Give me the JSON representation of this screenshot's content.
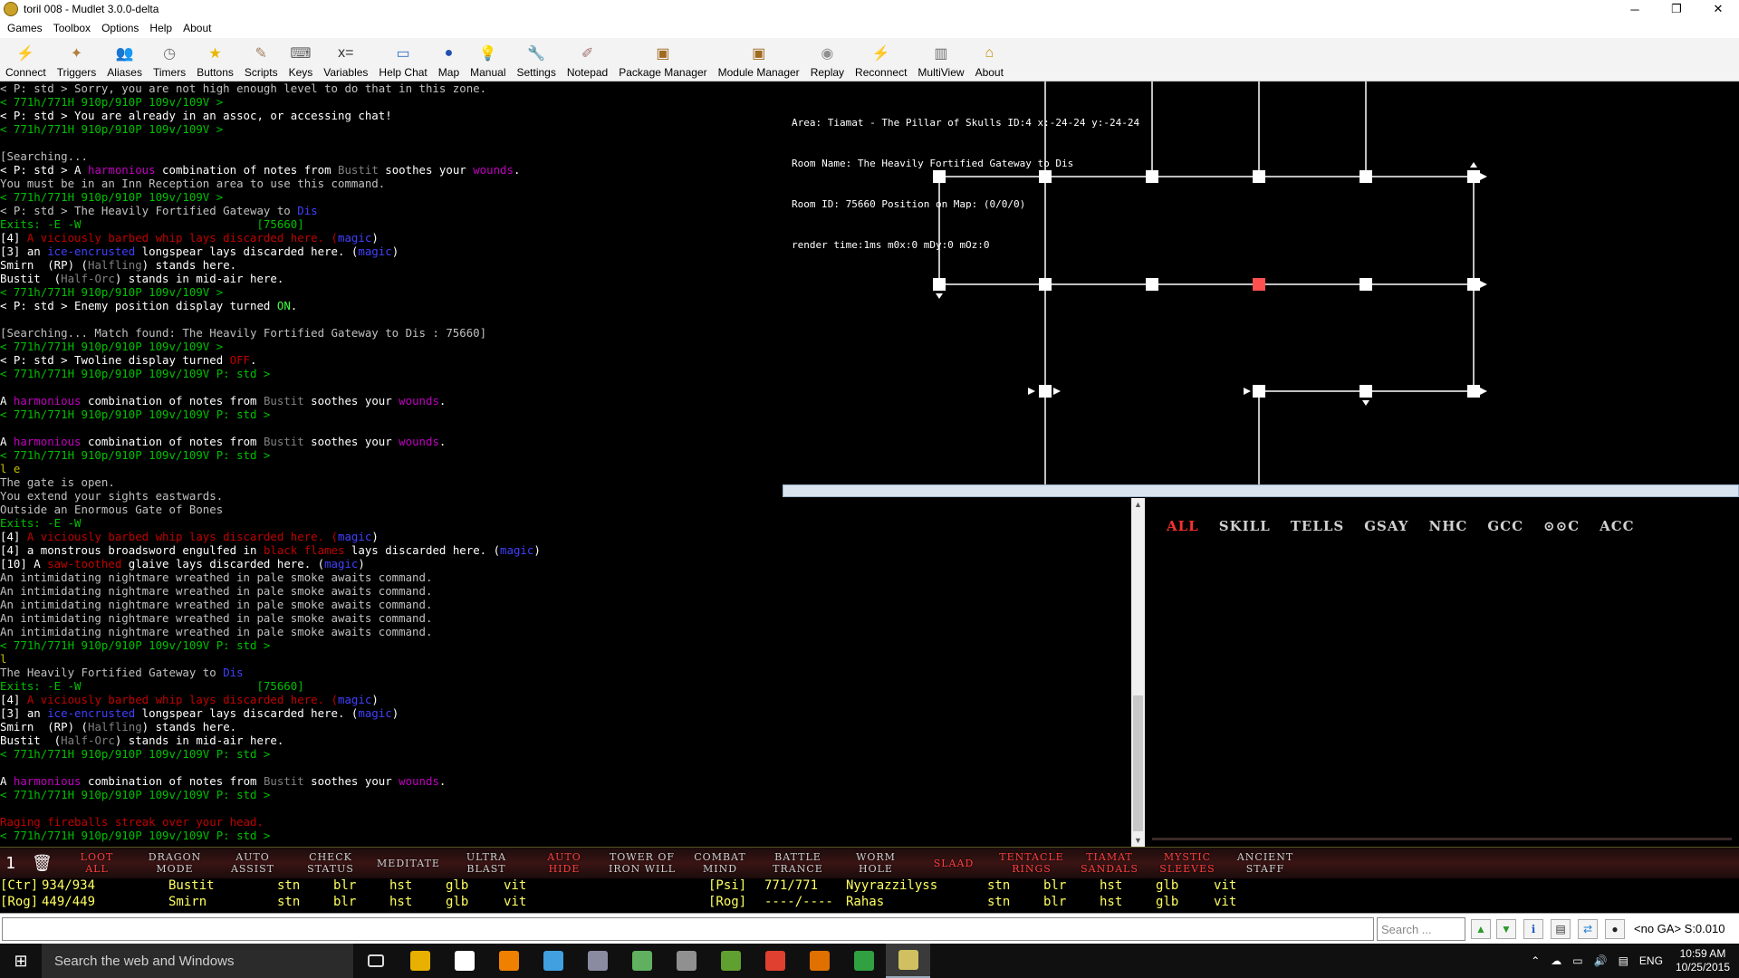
{
  "window": {
    "title": "toril 008 - Mudlet 3.0.0-delta",
    "minimize": "─",
    "maximize": "❐",
    "close": "✕"
  },
  "menu": [
    "Games",
    "Toolbox",
    "Options",
    "Help",
    "About"
  ],
  "toolbar": [
    {
      "label": "Connect",
      "icon": "connect-icon",
      "glyph": "⚡",
      "color": "#e8a000"
    },
    {
      "label": "Triggers",
      "icon": "triggers-icon",
      "glyph": "✦",
      "color": "#b08040"
    },
    {
      "label": "Aliases",
      "icon": "aliases-icon",
      "glyph": "👥",
      "color": "#806040"
    },
    {
      "label": "Timers",
      "icon": "timers-icon",
      "glyph": "◷",
      "color": "#707070"
    },
    {
      "label": "Buttons",
      "icon": "buttons-icon",
      "glyph": "★",
      "color": "#e8b800"
    },
    {
      "label": "Scripts",
      "icon": "scripts-icon",
      "glyph": "✎",
      "color": "#a08060"
    },
    {
      "label": "Keys",
      "icon": "keys-icon",
      "glyph": "⌨",
      "color": "#606060"
    },
    {
      "label": "Variables",
      "icon": "variables-icon",
      "glyph": "x=",
      "color": "#333333"
    },
    {
      "label": "Help Chat",
      "icon": "help-chat-icon",
      "glyph": "▭",
      "color": "#3070c0"
    },
    {
      "label": "Map",
      "icon": "map-icon",
      "glyph": "●",
      "color": "#2050b0"
    },
    {
      "label": "Manual",
      "icon": "manual-icon",
      "glyph": "💡",
      "color": "#e0c000"
    },
    {
      "label": "Settings",
      "icon": "settings-icon",
      "glyph": "🔧",
      "color": "#808080"
    },
    {
      "label": "Notepad",
      "icon": "notepad-icon",
      "glyph": "✐",
      "color": "#a07070"
    },
    {
      "label": "Package Manager",
      "icon": "package-manager-icon",
      "glyph": "▣",
      "color": "#a06a20"
    },
    {
      "label": "Module Manager",
      "icon": "module-manager-icon",
      "glyph": "▣",
      "color": "#a06a20"
    },
    {
      "label": "Replay",
      "icon": "replay-icon",
      "glyph": "◉",
      "color": "#909090"
    },
    {
      "label": "Reconnect",
      "icon": "reconnect-icon",
      "glyph": "⚡",
      "color": "#e8a000"
    },
    {
      "label": "MultiView",
      "icon": "multiview-icon",
      "glyph": "▥",
      "color": "#707070"
    },
    {
      "label": "About",
      "icon": "about-icon",
      "glyph": "⌂",
      "color": "#c09000"
    }
  ],
  "console": [
    [
      [
        "< P: std > Sorry, you are not high enough level to do that in this zone.",
        "gray"
      ]
    ],
    [
      [
        "< 771h/771H 910p/910P 109v/109V >",
        "green"
      ]
    ],
    [
      [
        "< P: std > You are already in an assoc, or accessing chat!",
        "white"
      ]
    ],
    [
      [
        "< 771h/771H 910p/910P 109v/109V >",
        "green"
      ]
    ],
    [
      [
        "",
        ""
      ]
    ],
    [
      [
        "[Searching...",
        "gray"
      ]
    ],
    [
      [
        "< P: std > A ",
        "white"
      ],
      [
        "harmonious",
        "purple"
      ],
      [
        " combination of notes from ",
        "white"
      ],
      [
        "Bustit",
        "dkgray"
      ],
      [
        " soothes your ",
        "white"
      ],
      [
        "wounds",
        "purple"
      ],
      [
        ".",
        "white"
      ]
    ],
    [
      [
        "You must be in an Inn Reception area to use this command.",
        "gray"
      ]
    ],
    [
      [
        "< 771h/771H 910p/910P 109v/109V >",
        "green"
      ]
    ],
    [
      [
        "< P: std > The Heavily Fortified Gateway to ",
        "gray"
      ],
      [
        "Dis",
        "blue"
      ]
    ],
    [
      [
        "Exits: -E -W                          [75660]",
        "green"
      ]
    ],
    [
      [
        "[4] ",
        "white"
      ],
      [
        "A viciously barbed whip lays discarded here. (",
        "red"
      ],
      [
        "magic",
        "blue"
      ],
      [
        ")",
        "white"
      ]
    ],
    [
      [
        "[3] an ",
        "white"
      ],
      [
        "ice-encrusted",
        "blue"
      ],
      [
        " longspear lays discarded here. (",
        "white"
      ],
      [
        "magic",
        "blue"
      ],
      [
        ")",
        "white"
      ]
    ],
    [
      [
        "Smirn  (RP) (",
        "white"
      ],
      [
        "Halfling",
        "dkgray"
      ],
      [
        ") stands here.",
        "white"
      ]
    ],
    [
      [
        "Bustit  (",
        "white"
      ],
      [
        "Half-Orc",
        "dkgray"
      ],
      [
        ") stands in mid-air here.",
        "white"
      ]
    ],
    [
      [
        "< 771h/771H 910p/910P 109v/109V >",
        "green"
      ]
    ],
    [
      [
        "< P: std > Enemy position display turned ",
        "white"
      ],
      [
        "ON",
        "lgreen"
      ],
      [
        ".",
        "white"
      ]
    ],
    [
      [
        "",
        ""
      ]
    ],
    [
      [
        "[Searching... Match found: The Heavily Fortified Gateway to Dis : 75660]",
        "gray"
      ]
    ],
    [
      [
        "< 771h/771H 910p/910P 109v/109V >",
        "green"
      ]
    ],
    [
      [
        "< P: std > Twoline display turned ",
        "white"
      ],
      [
        "OFF",
        "red"
      ],
      [
        ".",
        "white"
      ]
    ],
    [
      [
        "< 771h/771H 910p/910P 109v/109V P: std >",
        "green"
      ]
    ],
    [
      [
        "",
        ""
      ]
    ],
    [
      [
        "A ",
        "white"
      ],
      [
        "harmonious",
        "purple"
      ],
      [
        " combination of notes from ",
        "white"
      ],
      [
        "Bustit",
        "dkgray"
      ],
      [
        " soothes your ",
        "white"
      ],
      [
        "wounds",
        "purple"
      ],
      [
        ".",
        "white"
      ]
    ],
    [
      [
        "< 771h/771H 910p/910P 109v/109V P: std >",
        "green"
      ]
    ],
    [
      [
        "",
        ""
      ]
    ],
    [
      [
        "A ",
        "white"
      ],
      [
        "harmonious",
        "purple"
      ],
      [
        " combination of notes from ",
        "white"
      ],
      [
        "Bustit",
        "dkgray"
      ],
      [
        " soothes your ",
        "white"
      ],
      [
        "wounds",
        "purple"
      ],
      [
        ".",
        "white"
      ]
    ],
    [
      [
        "< 771h/771H 910p/910P 109v/109V P: std >",
        "green"
      ]
    ],
    [
      [
        "l e",
        "yellow"
      ]
    ],
    [
      [
        "The gate is open.",
        "gray"
      ]
    ],
    [
      [
        "You extend your sights eastwards.",
        "gray"
      ]
    ],
    [
      [
        "Outside an Enormous Gate of Bones",
        "gray"
      ]
    ],
    [
      [
        "Exits: -E -W",
        "green"
      ]
    ],
    [
      [
        "[4] ",
        "white"
      ],
      [
        "A viciously barbed whip lays discarded here. (",
        "red"
      ],
      [
        "magic",
        "blue"
      ],
      [
        ")",
        "white"
      ]
    ],
    [
      [
        "[4] a monstrous broadsword engulfed in ",
        "white"
      ],
      [
        "black flames",
        "red"
      ],
      [
        " lays discarded here. (",
        "white"
      ],
      [
        "magic",
        "blue"
      ],
      [
        ")",
        "white"
      ]
    ],
    [
      [
        "[10] A ",
        "white"
      ],
      [
        "saw-toothed",
        "red"
      ],
      [
        " glaive lays discarded here. (",
        "white"
      ],
      [
        "magic",
        "blue"
      ],
      [
        ")",
        "white"
      ]
    ],
    [
      [
        "An intimidating nightmare wreathed in pale smoke awaits command.",
        "gray"
      ]
    ],
    [
      [
        "An intimidating nightmare wreathed in pale smoke awaits command.",
        "gray"
      ]
    ],
    [
      [
        "An intimidating nightmare wreathed in pale smoke awaits command.",
        "gray"
      ]
    ],
    [
      [
        "An intimidating nightmare wreathed in pale smoke awaits command.",
        "gray"
      ]
    ],
    [
      [
        "An intimidating nightmare wreathed in pale smoke awaits command.",
        "gray"
      ]
    ],
    [
      [
        "< 771h/771H 910p/910P 109v/109V P: std >",
        "green"
      ]
    ],
    [
      [
        "l",
        "yellow"
      ]
    ],
    [
      [
        "The Heavily Fortified Gateway to ",
        "gray"
      ],
      [
        "Dis",
        "blue"
      ]
    ],
    [
      [
        "Exits: -E -W                          [75660]",
        "green"
      ]
    ],
    [
      [
        "[4] ",
        "white"
      ],
      [
        "A viciously barbed whip lays discarded here. (",
        "red"
      ],
      [
        "magic",
        "blue"
      ],
      [
        ")",
        "white"
      ]
    ],
    [
      [
        "[3] an ",
        "white"
      ],
      [
        "ice-encrusted",
        "blue"
      ],
      [
        " longspear lays discarded here. (",
        "white"
      ],
      [
        "magic",
        "blue"
      ],
      [
        ")",
        "white"
      ]
    ],
    [
      [
        "Smirn  (RP) (",
        "white"
      ],
      [
        "Halfling",
        "dkgray"
      ],
      [
        ") stands here.",
        "white"
      ]
    ],
    [
      [
        "Bustit  (",
        "white"
      ],
      [
        "Half-Orc",
        "dkgray"
      ],
      [
        ") stands in mid-air here.",
        "white"
      ]
    ],
    [
      [
        "< 771h/771H 910p/910P 109v/109V P: std >",
        "green"
      ]
    ],
    [
      [
        "",
        ""
      ]
    ],
    [
      [
        "A ",
        "white"
      ],
      [
        "harmonious",
        "purple"
      ],
      [
        " combination of notes from ",
        "white"
      ],
      [
        "Bustit",
        "dkgray"
      ],
      [
        " soothes your ",
        "white"
      ],
      [
        "wounds",
        "purple"
      ],
      [
        ".",
        "white"
      ]
    ],
    [
      [
        "< 771h/771H 910p/910P 109v/109V P: std >",
        "green"
      ]
    ],
    [
      [
        "",
        ""
      ]
    ],
    [
      [
        "Raging fireballs streak over your head.",
        "red"
      ]
    ],
    [
      [
        "< 771h/771H 910p/910P 109v/109V P: std >",
        "green"
      ]
    ]
  ],
  "map": {
    "info": [
      "Area: Tiamat - The Pillar of Skulls ID:4 x:-24-24 y:-24-24",
      "Room Name: The Heavily Fortified Gateway to Dis",
      "Room ID: 75660 Position on Map: (0/0/0)",
      "render time:1ms m0x:0 mDy:0 mOz:0"
    ],
    "current_room_color": "#ff5050"
  },
  "chat_tabs": [
    "ALL",
    "SKILL",
    "TELLS",
    "GSAY",
    "NHC",
    "GCC",
    "⊙⊙C",
    "ACC"
  ],
  "button_bar": {
    "page": "1",
    "buttons": [
      {
        "l1": "Loot",
        "l2": "All",
        "red": true
      },
      {
        "l1": "Dragon",
        "l2": "Mode",
        "red": false
      },
      {
        "l1": "Auto",
        "l2": "Assist",
        "red": false
      },
      {
        "l1": "Check",
        "l2": "Status",
        "red": false
      },
      {
        "l1": "Meditate",
        "l2": "",
        "red": false
      },
      {
        "l1": "Ultra",
        "l2": "Blast",
        "red": false
      },
      {
        "l1": "Auto",
        "l2": "Hide",
        "red": true
      },
      {
        "l1": "Tower of",
        "l2": "Iron Will",
        "red": false
      },
      {
        "l1": "Combat",
        "l2": "Mind",
        "red": false
      },
      {
        "l1": "Battle",
        "l2": "Trance",
        "red": false
      },
      {
        "l1": "Worm",
        "l2": "Hole",
        "red": false
      },
      {
        "l1": "Slaad",
        "l2": "",
        "red": true
      },
      {
        "l1": "Tentacle",
        "l2": "Rings",
        "red": true
      },
      {
        "l1": "Tiamat",
        "l2": "Sandals",
        "red": true
      },
      {
        "l1": "Mystic",
        "l2": "Sleeves",
        "red": true
      },
      {
        "l1": "Ancient",
        "l2": "Staff",
        "red": false
      }
    ]
  },
  "group": {
    "rows": [
      [
        "[Ctr]",
        "934/934",
        "Bustit",
        "stn",
        "blr",
        "hst",
        "glb",
        "vit",
        "[Psi]",
        "771/771",
        "Nyyrazzilyss",
        "stn",
        "blr",
        "hst",
        "glb",
        "vit"
      ],
      [
        "[Rog]",
        "449/449",
        "Smirn",
        "stn",
        "blr",
        "hst",
        "glb",
        "vit",
        "[Rog]",
        "----/----",
        "Rahas",
        "stn",
        "blr",
        "hst",
        "glb",
        "vit"
      ]
    ]
  },
  "command": {
    "input_value": "",
    "search_placeholder": "Search ...",
    "status": "<no GA> S:0.010"
  },
  "taskbar": {
    "search_placeholder": "Search the web and Windows",
    "lang": "ENG",
    "time": "10:59 AM",
    "date": "10/25/2015",
    "apps": [
      {
        "name": "task-view-icon",
        "color": "#101010"
      },
      {
        "name": "file-explorer-icon",
        "color": "#e8b000"
      },
      {
        "name": "store-icon",
        "color": "#ffffff"
      },
      {
        "name": "vlc-icon",
        "color": "#f08000"
      },
      {
        "name": "app-blue-icon",
        "color": "#40a0e0"
      },
      {
        "name": "library-icon",
        "color": "#8a8aa0"
      },
      {
        "name": "notepad-plus-icon",
        "color": "#60b060"
      },
      {
        "name": "database-icon",
        "color": "#909090"
      },
      {
        "name": "green-app-icon",
        "color": "#60a030"
      },
      {
        "name": "chrome-icon",
        "color": "#e04030"
      },
      {
        "name": "editor-icon",
        "color": "#e07000"
      },
      {
        "name": "excel-icon",
        "color": "#30a040"
      },
      {
        "name": "mudlet-icon",
        "color": "#d0c060"
      }
    ]
  }
}
